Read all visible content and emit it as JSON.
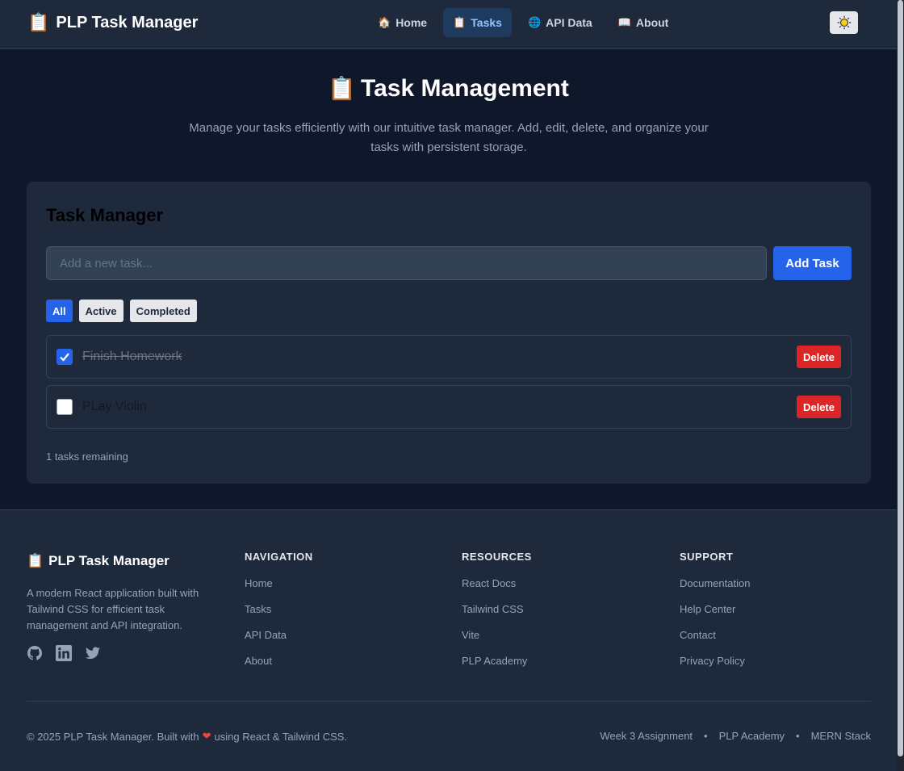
{
  "navbar": {
    "icon": "clipboard-icon",
    "brand": "PLP Task Manager",
    "links": [
      {
        "label": "Home",
        "icon": "home-icon",
        "glyph": "🏠"
      },
      {
        "label": "Tasks",
        "icon": "clipboard-icon",
        "glyph": "📋"
      },
      {
        "label": "API Data",
        "icon": "globe-icon",
        "glyph": "🌐"
      },
      {
        "label": "About",
        "icon": "book-icon",
        "glyph": "📖"
      }
    ],
    "active_link": "Tasks",
    "theme_toggle_icon": "sun-icon"
  },
  "hero": {
    "icon": "clipboard-icon",
    "title": "Task Management",
    "subtitle": "Manage your tasks efficiently with our intuitive task manager. Add, edit, delete, and organize your tasks with persistent storage."
  },
  "task_manager": {
    "title": "Task Manager",
    "input": {
      "value": "",
      "placeholder": "Add a new task..."
    },
    "add_label": "Add Task",
    "filters": [
      {
        "label": "All",
        "active": true
      },
      {
        "label": "Active",
        "active": false
      },
      {
        "label": "Completed",
        "active": false
      }
    ],
    "tasks": [
      {
        "text": "Finish Homework",
        "completed": true,
        "delete_label": "Delete"
      },
      {
        "text": "PLay Violin",
        "completed": false,
        "delete_label": "Delete"
      }
    ],
    "remaining": "1 tasks remaining"
  },
  "footer": {
    "brand": "PLP Task Manager",
    "description": "A modern React application built with Tailwind CSS for efficient task management and API integration.",
    "socials": [
      "github-icon",
      "linkedin-icon",
      "twitter-icon"
    ],
    "columns": [
      {
        "heading": "NAVIGATION",
        "links": [
          "Home",
          "Tasks",
          "API Data",
          "About"
        ]
      },
      {
        "heading": "RESOURCES",
        "links": [
          "React Docs",
          "Tailwind CSS",
          "Vite",
          "PLP Academy"
        ]
      },
      {
        "heading": "SUPPORT",
        "links": [
          "Documentation",
          "Help Center",
          "Contact",
          "Privacy Policy"
        ]
      }
    ],
    "copyright_prefix": "© 2025 PLP Task Manager.  Built with",
    "copyright_suffix": "using React & Tailwind CSS.",
    "right_links": [
      "Week 3 Assignment",
      "PLP Academy",
      "MERN Stack"
    ],
    "separator": "•"
  },
  "colors": {
    "accent": "#2563eb",
    "danger": "#dc2626",
    "background": "#0f172a",
    "surface": "#1e293b"
  }
}
